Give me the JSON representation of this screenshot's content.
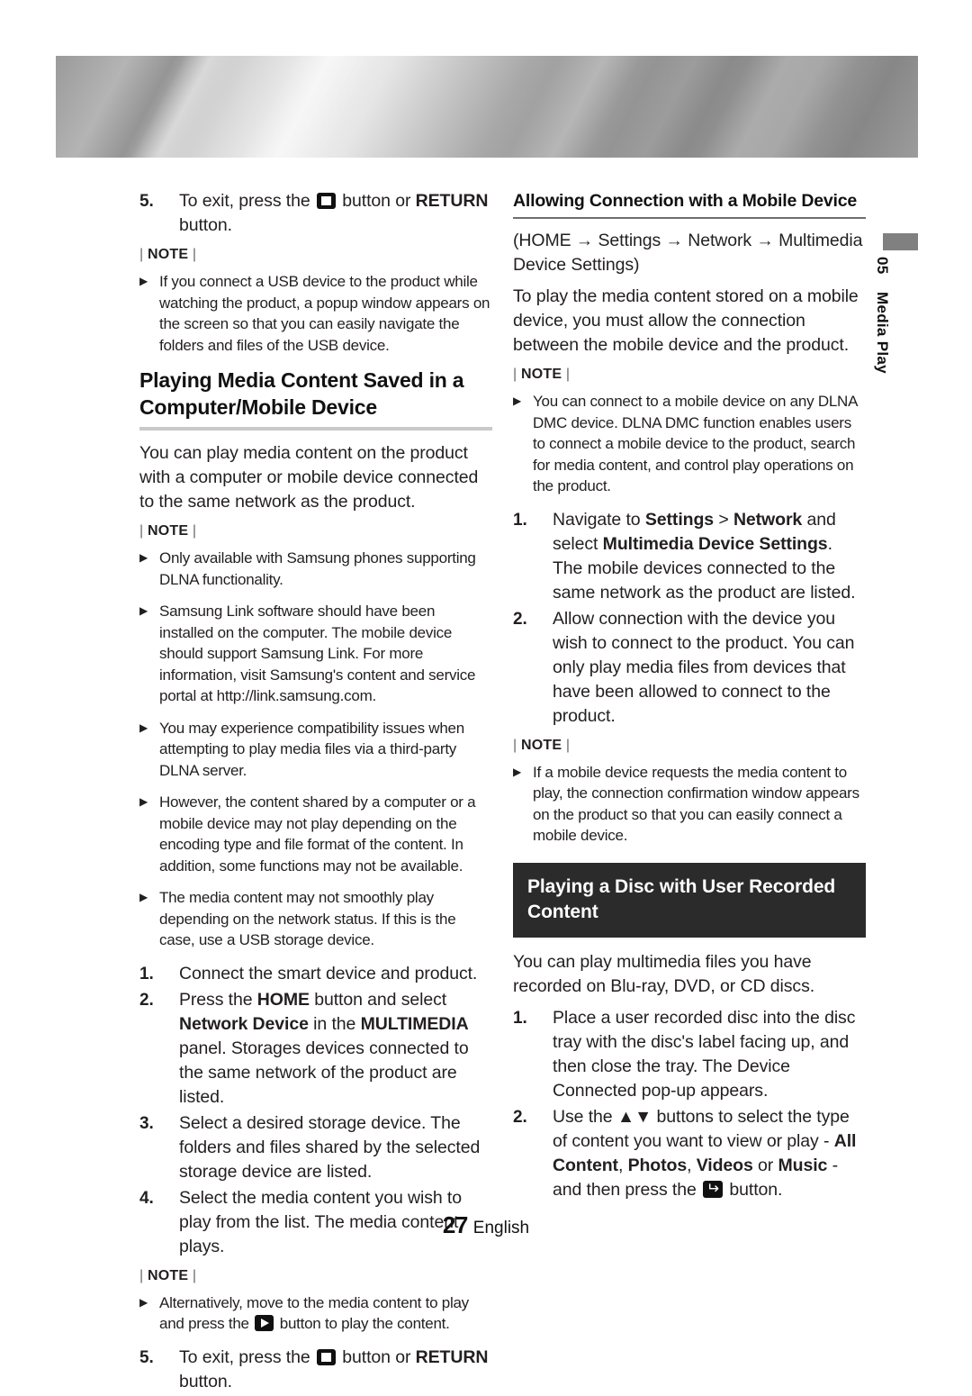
{
  "page": {
    "number": "27",
    "language": "English",
    "side_tab_chapter_number": "05",
    "side_tab_chapter_name": "Media Play"
  },
  "icons": {
    "stop": "stop-button-icon",
    "play": "play-button-icon",
    "enter": "enter-button-icon"
  },
  "note_label": "NOTE",
  "left_column": {
    "step5_top": {
      "num": "5.",
      "text_before": "To exit, press the",
      "text_after_icon": "button or",
      "bold_return": "RETURN",
      "text_end": "button."
    },
    "note1_bullets": [
      "If you connect a USB device to the product while watching the product, a popup window appears on the screen so that you can easily navigate the folders and files of the USB device."
    ],
    "heading": "Playing Media Content Saved in a Computer/Mobile Device",
    "intro": "You can play media content on the product with a computer or mobile device connected to the same network as the product.",
    "note2_bullets": [
      "Only available with Samsung phones supporting DLNA functionality.",
      "Samsung Link software should have been installed on the computer. The mobile device should support Samsung Link. For more information, visit Samsung's content and service portal at http://link.samsung.com.",
      "You may experience compatibility issues when attempting to play media files via a third-party DLNA server.",
      "However, the content shared by a computer or a mobile device may not play depending on the encoding type and file format of the content. In addition, some functions may not be available.",
      "The media content may not smoothly play depending on the network status. If this is the case, use a USB storage device."
    ],
    "steps": [
      {
        "num": "1.",
        "text": "Connect the smart device and product."
      },
      {
        "num": "2.",
        "text": "Press the HOME button and select Network Device in the MULTIMEDIA panel. Storages devices connected to the same network of the product are listed."
      },
      {
        "num": "3.",
        "text": "Select a desired storage device. The folders and files shared by the selected storage device are listed."
      },
      {
        "num": "4.",
        "text": "Select the media content you wish to play from the list. The media content plays."
      }
    ],
    "note3_bullet": {
      "text_before": "Alternatively, move to the media content to play and press the",
      "text_after": "button to play the content."
    },
    "step5_bottom": {
      "num": "5.",
      "text_before": "To exit, press the",
      "text_after_icon": "button or",
      "bold_return": "RETURN",
      "text_end": "button."
    }
  },
  "right_column": {
    "heading": "Allowing Connection with a Mobile Device",
    "path_line": "(HOME → Settings → Network → Multimedia Device Settings)",
    "intro": "To play the media content stored on a mobile device, you must allow the connection between the mobile device and the product.",
    "note1_bullets": [
      "You can connect to a mobile device on any DLNA DMC device. DLNA DMC function enables users to connect a mobile device to the product, search for media content, and control play operations on the product."
    ],
    "steps": [
      {
        "num": "1.",
        "text": "Navigate to Settings > Network and select Multimedia Device Settings. The mobile devices connected to the same network as the product are listed."
      },
      {
        "num": "2.",
        "text": "Allow connection with the device you wish to connect to the product. You can only play media files from devices that have been allowed to connect to the product."
      }
    ],
    "note2_bullets": [
      "If a mobile device requests the media content to play, the connection confirmation window appears on the product so that you can easily connect a mobile device."
    ],
    "boxed_heading": "Playing a Disc with User Recorded Content",
    "intro2": "You can play multimedia files you have recorded on Blu-ray, DVD, or CD discs.",
    "steps2": [
      {
        "num": "1.",
        "text": "Place a user recorded disc into the disc tray with the disc's label facing up, and then close the tray. The Device Connected pop-up appears."
      }
    ],
    "step2_parts": {
      "num": "2.",
      "a": "Use the ▲▼ buttons to select the type of content you want to view or play -",
      "b1": "All Content",
      "b2": "Photos",
      "b3": "Videos",
      "b4": "Music",
      "joiner_or": "or",
      "tail": "- and then press the",
      "tail2": "button."
    }
  }
}
